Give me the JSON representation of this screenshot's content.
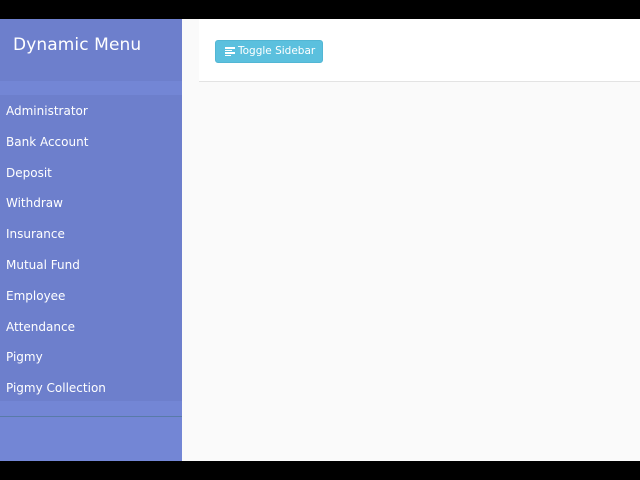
{
  "sidebar": {
    "title": "Dynamic Menu",
    "items": [
      {
        "label": "Administrator"
      },
      {
        "label": "Bank Account"
      },
      {
        "label": "Deposit"
      },
      {
        "label": "Withdraw"
      },
      {
        "label": "Insurance"
      },
      {
        "label": "Mutual Fund"
      },
      {
        "label": "Employee"
      },
      {
        "label": "Attendance"
      },
      {
        "label": "Pigmy"
      },
      {
        "label": "Pigmy Collection"
      }
    ]
  },
  "navbar": {
    "toggle_label": "Toggle Sidebar",
    "toggle_icon": "align-left-icon"
  },
  "colors": {
    "sidebar_bg": "#7386d5",
    "sidebar_menu_bg": "#6d7fcc",
    "button_bg": "#5bc0de",
    "content_bg": "#fafafa",
    "text_light": "#ffffff"
  }
}
